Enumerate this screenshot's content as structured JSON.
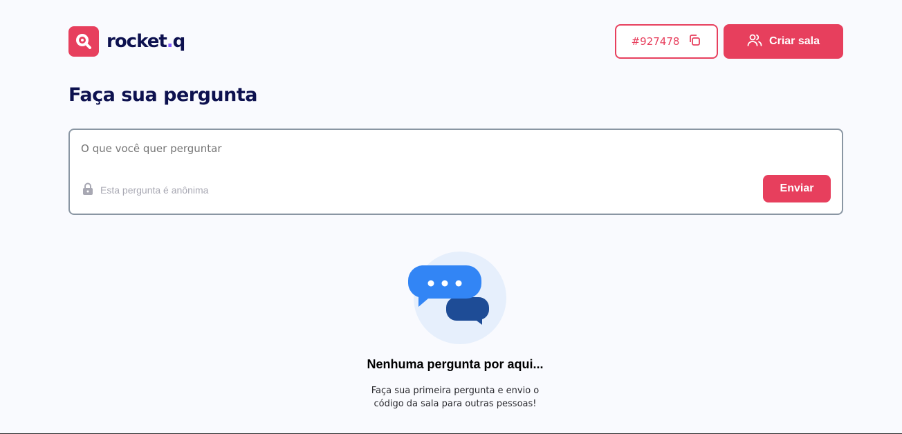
{
  "app": {
    "logo_text_main": "rocket",
    "logo_text_dot": ".",
    "logo_text_end": "q"
  },
  "header": {
    "room_code": "#927478",
    "create_room_label": "Criar sala"
  },
  "page": {
    "title": "Faça sua pergunta"
  },
  "form": {
    "question_placeholder": "O que você quer perguntar",
    "anonymous_label": "Esta pergunta é anônima",
    "send_label": "Enviar"
  },
  "empty_state": {
    "title": "Nenhuma pergunta por aqui...",
    "description_line1": "Faça sua primeira pergunta e envio o",
    "description_line2": "código da sala para outras pessoas!"
  },
  "colors": {
    "accent": "#e73f5d",
    "brand_dark": "#0d114f",
    "bubble_light": "#3b82f6",
    "bubble_dark": "#1e3a8a",
    "bubble_bg": "#e6effc"
  },
  "icons": {
    "logo": "rocketq-logo-icon",
    "copy": "copy-icon",
    "users": "users-icon",
    "lock": "lock-icon",
    "chat": "chat-bubbles-icon"
  }
}
